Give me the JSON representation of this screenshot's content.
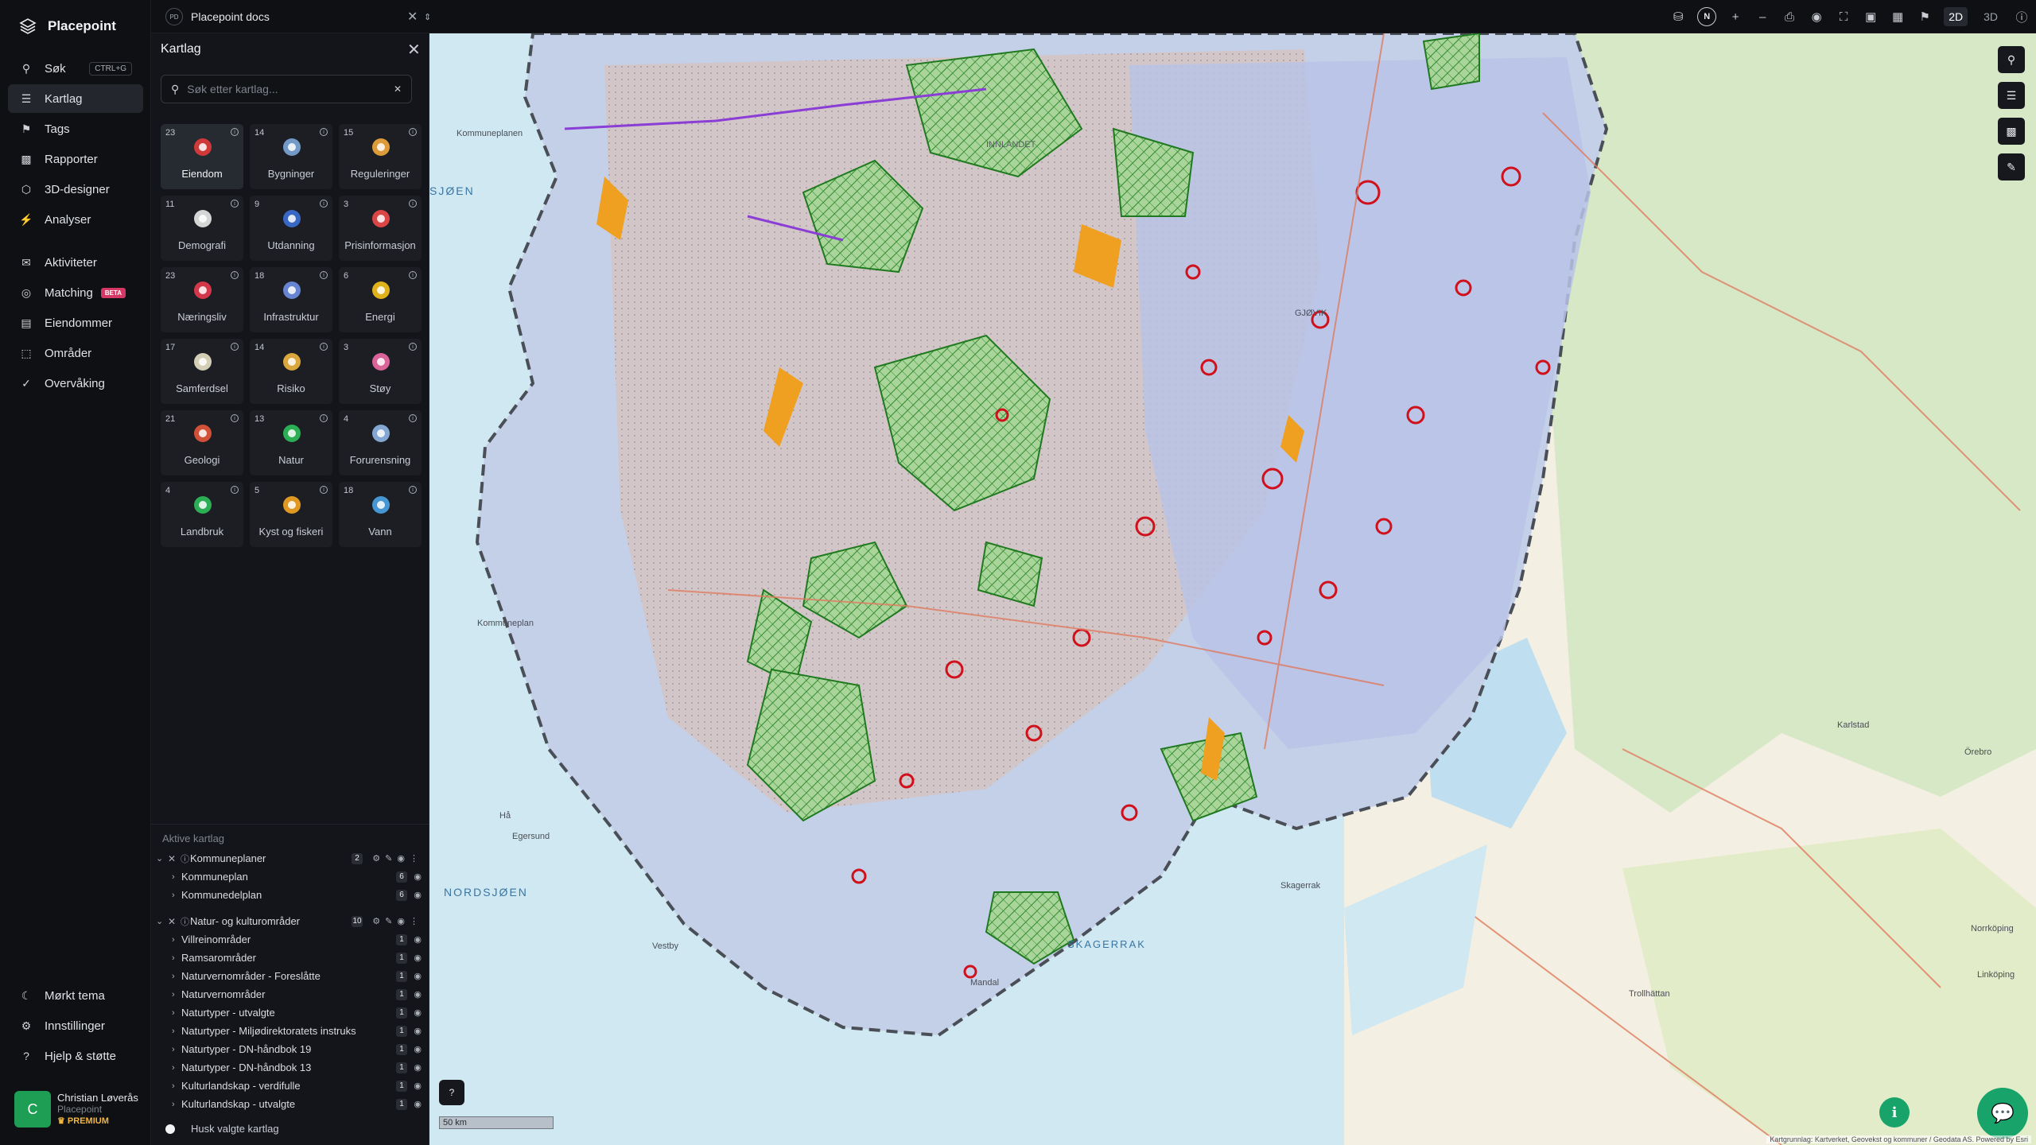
{
  "app": {
    "name": "Placepoint"
  },
  "nav": {
    "items": [
      {
        "label": "Søk",
        "icon": "search-icon",
        "shortcut": "CTRL+G"
      },
      {
        "label": "Kartlag",
        "icon": "layers-icon",
        "active": true
      },
      {
        "label": "Tags",
        "icon": "bookmark-icon"
      },
      {
        "label": "Rapporter",
        "icon": "bar-chart-icon"
      },
      {
        "label": "3D-designer",
        "icon": "cube-icon"
      },
      {
        "label": "Analyser",
        "icon": "bolt-icon"
      }
    ],
    "items2": [
      {
        "label": "Aktiviteter",
        "icon": "chat-icon"
      },
      {
        "label": "Matching",
        "icon": "target-icon",
        "badge": "BETA"
      },
      {
        "label": "Eiendommer",
        "icon": "document-icon"
      },
      {
        "label": "Områder",
        "icon": "area-icon"
      },
      {
        "label": "Overvåking",
        "icon": "check-circle-icon"
      }
    ],
    "bottom": [
      {
        "label": "Mørkt tema",
        "icon": "moon-icon"
      },
      {
        "label": "Innstillinger",
        "icon": "gear-icon"
      },
      {
        "label": "Hjelp & støtte",
        "icon": "help-icon"
      }
    ],
    "user": {
      "initial": "C",
      "name": "Christian Løverås",
      "org": "Placepoint",
      "tier": "PREMIUM"
    }
  },
  "topbar": {
    "workspace_badge": "PD",
    "workspace": "Placepoint docs",
    "compass": "N",
    "mode_2d": "2D",
    "mode_3d": "3D",
    "active_mode": "2D"
  },
  "panel": {
    "title": "Kartlag",
    "search_placeholder": "Søk etter kartlag...",
    "categories": [
      {
        "count": "23",
        "label": "Eiendom",
        "icon": "pin-icon",
        "color": "#e23b3b",
        "selected": true
      },
      {
        "count": "14",
        "label": "Bygninger",
        "icon": "building-icon",
        "color": "#7da6d9"
      },
      {
        "count": "15",
        "label": "Reguleringer",
        "icon": "signpost-icon",
        "color": "#f2a73b"
      },
      {
        "count": "11",
        "label": "Demografi",
        "icon": "people-icon",
        "color": "#e9e9e9"
      },
      {
        "count": "9",
        "label": "Utdanning",
        "icon": "graduation-icon",
        "color": "#3d6fd6"
      },
      {
        "count": "3",
        "label": "Prisinformasjon",
        "icon": "bag-icon",
        "color": "#ef4a4a"
      },
      {
        "count": "23",
        "label": "Næringsliv",
        "icon": "shop-icon",
        "color": "#e83b4f"
      },
      {
        "count": "18",
        "label": "Infrastruktur",
        "icon": "globe-icon",
        "color": "#6f8fe6"
      },
      {
        "count": "6",
        "label": "Energi",
        "icon": "lightning-icon",
        "color": "#f5c21b"
      },
      {
        "count": "17",
        "label": "Samferdsel",
        "icon": "bus-icon",
        "color": "#e8e2c8"
      },
      {
        "count": "14",
        "label": "Risiko",
        "icon": "hazard-icon",
        "color": "#f0b640"
      },
      {
        "count": "3",
        "label": "Støy",
        "icon": "noise-icon",
        "color": "#ef6aa5"
      },
      {
        "count": "21",
        "label": "Geologi",
        "icon": "terrain-icon",
        "color": "#e5553b"
      },
      {
        "count": "13",
        "label": "Natur",
        "icon": "leaf-icon",
        "color": "#2fbf5a"
      },
      {
        "count": "4",
        "label": "Forurensning",
        "icon": "factory-icon",
        "color": "#8fb6e6"
      },
      {
        "count": "4",
        "label": "Landbruk",
        "icon": "sprout-icon",
        "color": "#2fbf5a"
      },
      {
        "count": "5",
        "label": "Kyst og fiskeri",
        "icon": "fish-icon",
        "color": "#f5a623"
      },
      {
        "count": "18",
        "label": "Vann",
        "icon": "water-drop-icon",
        "color": "#4aa3e6"
      }
    ],
    "active_title": "Aktive kartlag",
    "groups": [
      {
        "label": "Kommuneplaner",
        "count": "2",
        "layers": [
          {
            "label": "Kommuneplan",
            "count": "6"
          },
          {
            "label": "Kommunedelplan",
            "count": "6"
          }
        ]
      },
      {
        "label": "Natur- og kulturområder",
        "count": "10",
        "layers": [
          {
            "label": "Villreinområder",
            "count": "1"
          },
          {
            "label": "Ramsarområder",
            "count": "1"
          },
          {
            "label": "Naturvernområder - Foreslåtte",
            "count": "1"
          },
          {
            "label": "Naturvernområder",
            "count": "1"
          },
          {
            "label": "Naturtyper - utvalgte",
            "count": "1"
          },
          {
            "label": "Naturtyper - Miljødirektoratets instruks",
            "count": "1"
          },
          {
            "label": "Naturtyper - DN-håndbok 19",
            "count": "1"
          },
          {
            "label": "Naturtyper - DN-håndbok 13",
            "count": "1"
          },
          {
            "label": "Kulturlandskap - verdifulle",
            "count": "1"
          },
          {
            "label": "Kulturlandskap - utvalgte",
            "count": "1"
          }
        ]
      }
    ],
    "remember_label": "Husk valgte kartlag"
  },
  "map": {
    "sea_labels": [
      "SJØEN",
      "NORDSJØEN",
      "SKAGERRAK"
    ],
    "place_labels": [
      "Kommuneplanen",
      "Kommuneplan",
      "INNLANDET",
      "GJØVIK",
      "Hå",
      "Egersund",
      "Mandal",
      "Vestby",
      "Karlstad",
      "Örebro",
      "Norrköping",
      "Linköping",
      "Trollhättan",
      "Skagerrak"
    ],
    "scale_label": "50 km",
    "attribution": "Kartgrunnlag: Kartverket, Geovekst og kommuner / Geodata AS. Powered by Esri"
  },
  "colors": {
    "accent": "#17a36a",
    "beta": "#d63866",
    "premium": "#f0b640"
  }
}
